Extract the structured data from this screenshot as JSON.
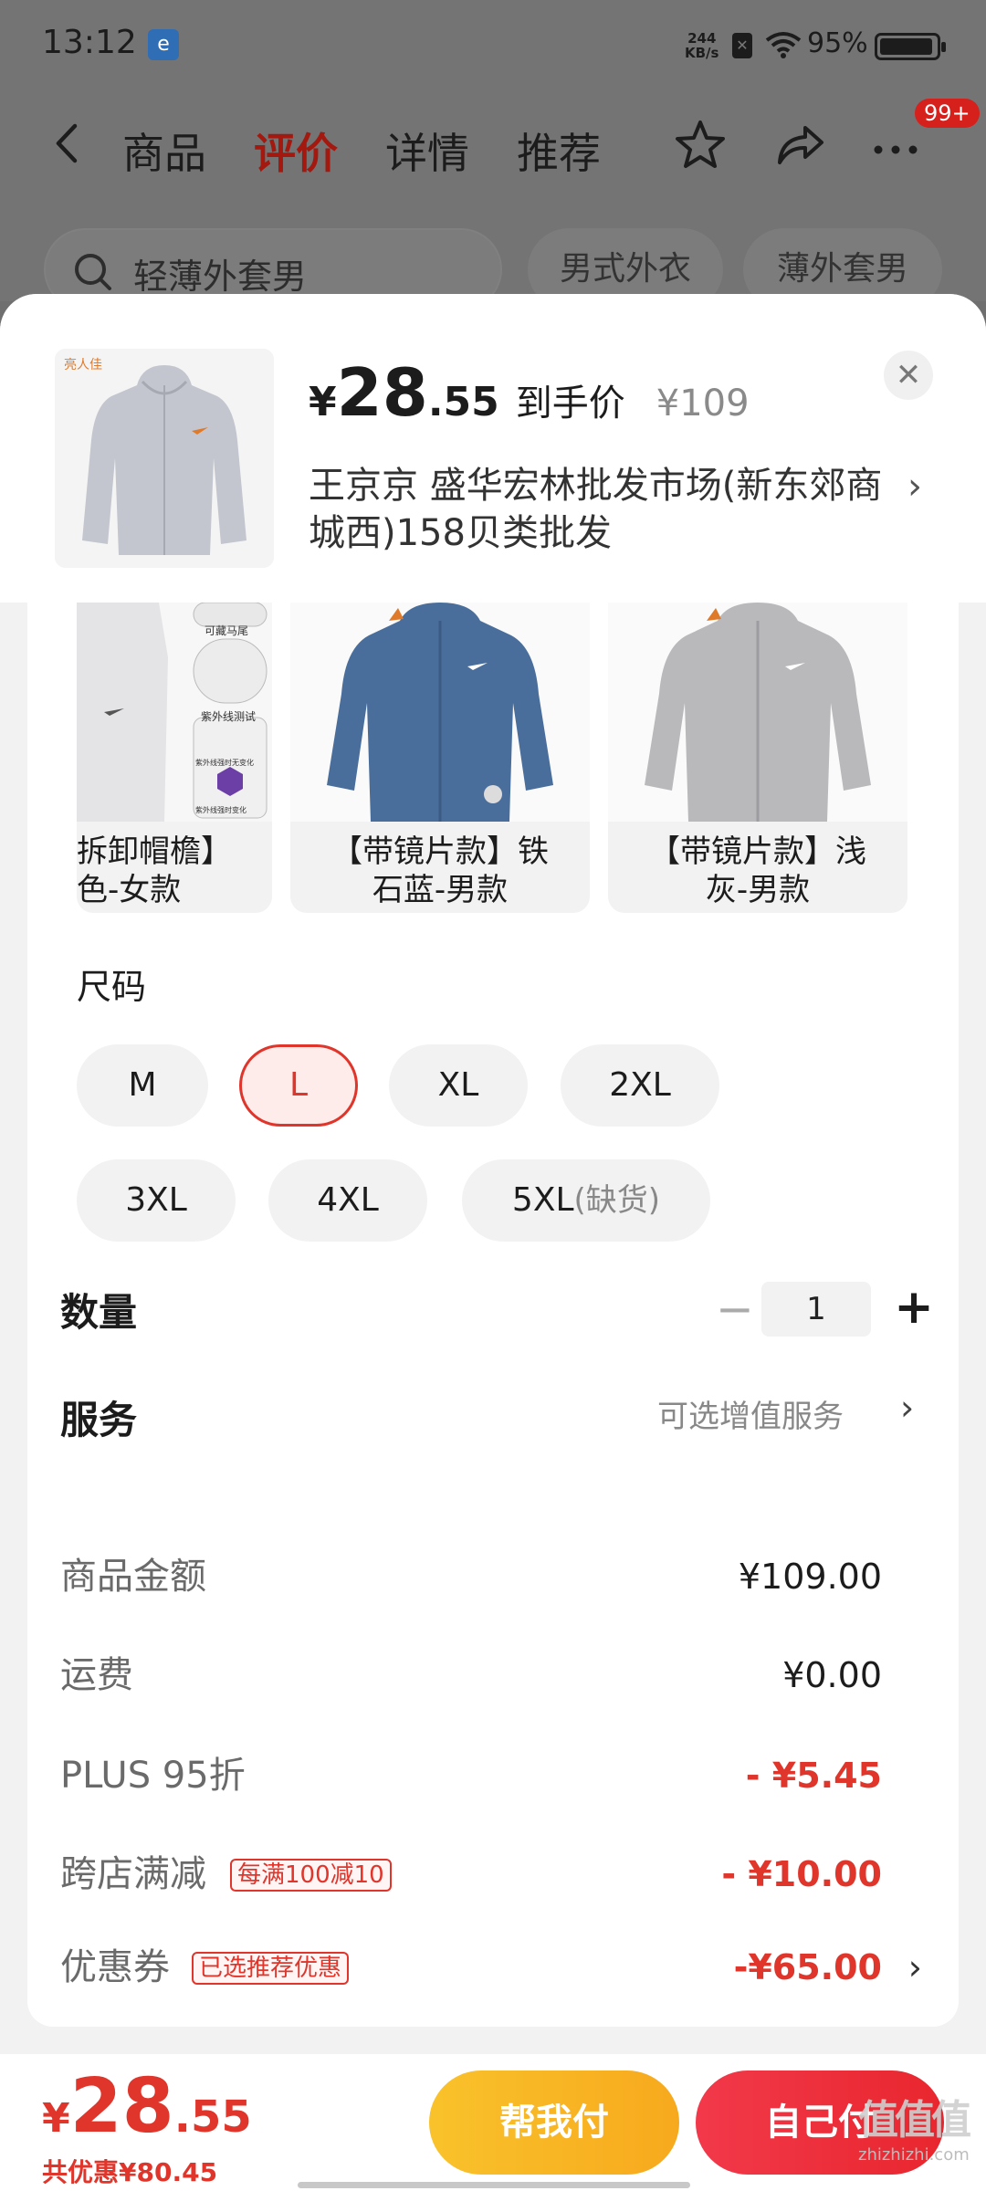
{
  "status_bar": {
    "time": "13:12",
    "speed_value": "244",
    "speed_unit": "KB/s",
    "battery": "95%",
    "battery_level": 0.95
  },
  "nav": {
    "tabs": [
      "商品",
      "评价",
      "详情",
      "推荐"
    ],
    "active_tab": "评价",
    "badge": "99+"
  },
  "search": {
    "placeholder": "轻薄外套男",
    "chips": [
      "男式外衣",
      "薄外套男"
    ]
  },
  "product": {
    "price_currency": "¥",
    "price_int": "28",
    "price_dec": ".55",
    "price_label": "到手价",
    "original_price": "¥109",
    "seller_address": "王京京  盛华宏林批发市场(新东郊商城西)158贝类批发"
  },
  "variants": [
    {
      "label": "拆卸帽檐】\n色-女款",
      "color": "#e9e9e9",
      "tags": [
        "可藏马尾",
        "紫外线测试",
        "紫外线强时无变化",
        "紫外线强时变化"
      ]
    },
    {
      "label": "【带镜片款】铁石蓝-男款",
      "color": "#4a6e9b"
    },
    {
      "label": "【带镜片款】浅灰-男款",
      "color": "#b9b9bc"
    }
  ],
  "size": {
    "title": "尺码",
    "options": [
      "M",
      "L",
      "XL",
      "2XL",
      "3XL",
      "4XL",
      "5XL"
    ],
    "selected": "L",
    "out_of_stock_suffix": "(缺货)"
  },
  "quantity": {
    "label": "数量",
    "value": "1",
    "minus": "−",
    "plus": "+"
  },
  "service": {
    "label": "服务",
    "value": "可选增值服务"
  },
  "summary": [
    {
      "label": "商品金额",
      "value": "¥109.00",
      "red": false
    },
    {
      "label": "运费",
      "value": "¥0.00",
      "red": false
    },
    {
      "label": "PLUS 95折",
      "value": "- ¥5.45",
      "red": true
    },
    {
      "label": "跨店满减",
      "tag": "每满100减10",
      "value": "- ¥10.00",
      "red": true
    },
    {
      "label": "优惠券",
      "tag": "已选推荐优惠",
      "value": "-¥65.00",
      "red": true,
      "chevron": true
    }
  ],
  "footer": {
    "currency": "¥",
    "total_int": "28",
    "total_dec": ".55",
    "total_discount": "共优惠¥80.45",
    "help_pay": "帮我付",
    "self_pay": "自己付",
    "watermark_glyph": "值值值",
    "watermark_url": "zhizhizhi.com"
  },
  "colors": {
    "accent_red": "#e0352b",
    "active_tab_red": "#a3180f",
    "help_button_yellow": "#f9c22b",
    "self_button_red": "#f2394a"
  }
}
